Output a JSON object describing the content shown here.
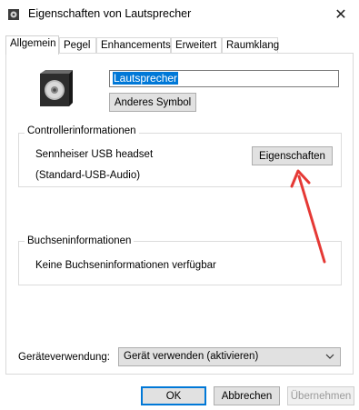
{
  "window": {
    "title": "Eigenschaften von Lautsprecher",
    "close_glyph": "✕"
  },
  "tabs": [
    "Allgemein",
    "Pegel",
    "Enhancements",
    "Erweitert",
    "Raumklang"
  ],
  "general": {
    "device_name": "Lautsprecher",
    "change_icon_label": "Anderes Symbol"
  },
  "controller": {
    "legend": "Controllerinformationen",
    "name": "Sennheiser USB headset",
    "driver": "(Standard-USB-Audio)",
    "properties_label": "Eigenschaften"
  },
  "jack": {
    "legend": "Buchseninformationen",
    "info": "Keine Buchseninformationen verfügbar"
  },
  "usage": {
    "label": "Geräteverwendung:",
    "selected": "Gerät verwenden (aktivieren)"
  },
  "footer": {
    "ok_label": "OK",
    "cancel_label": "Abbrechen",
    "apply_label": "Übernehmen"
  },
  "colors": {
    "accent": "#0078d7",
    "annotation_arrow": "#e53935"
  }
}
